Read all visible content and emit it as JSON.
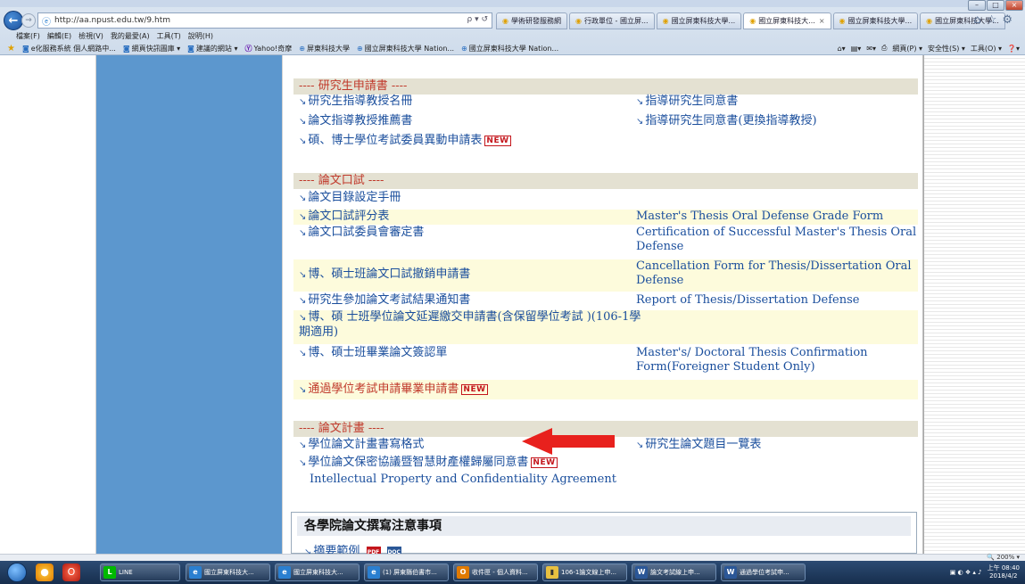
{
  "browser": {
    "url": "http://aa.npust.edu.tw/9.htm",
    "address_controls": "ρ ▾ ↺",
    "tabs": [
      {
        "label": "學術研發服務網",
        "active": false
      },
      {
        "label": "行政單位 - 國立屏...",
        "active": false
      },
      {
        "label": "國立屏東科技大學...",
        "active": false
      },
      {
        "label": "國立屏東科技大...",
        "active": true
      },
      {
        "label": "國立屏東科技大學...",
        "active": false
      },
      {
        "label": "國立屏東科技大學...",
        "active": false
      }
    ],
    "menu": [
      "檔案(F)",
      "編輯(E)",
      "檢視(V)",
      "我的最愛(A)",
      "工具(T)",
      "說明(H)"
    ],
    "favorites": [
      "e化服務系統 個人網路中...",
      "網頁快訊圖庫 ▾",
      "建議的網站 ▾",
      "Yahoo!奇摩",
      "屏東科技大學",
      "國立屏東科技大學 Nation...",
      "國立屏東科技大學 Nation..."
    ],
    "command_bar": [
      "▾",
      "▾",
      "▾",
      "網頁(P) ▾",
      "安全性(S) ▾",
      "工具(O) ▾",
      "▾"
    ],
    "zoom": "200%"
  },
  "sections": {
    "grad_apps": {
      "title": "---- 研究生申請書 ----",
      "rows": [
        {
          "left": "研究生指導教授名冊",
          "right": "指導研究生同意書",
          "new": false
        },
        {
          "left": "論文指導教授推薦書",
          "right": "指導研究生同意書(更換指導教授)",
          "new": false
        },
        {
          "left": "碩、博士學位考試委員異動申請表",
          "right": "",
          "new": true
        }
      ]
    },
    "oral_exam": {
      "title": "---- 論文口試 ----",
      "rows": [
        {
          "left": "論文目錄設定手冊",
          "right": ""
        },
        {
          "left": "論文口試評分表",
          "right": "Master's Thesis Oral Defense Grade Form"
        },
        {
          "left": "論文口試委員會審定書",
          "right": "Certification of Successful Master's Thesis Oral Defense"
        },
        {
          "left": "博、碩士班論文口試撤銷申請書",
          "right": "Cancellation Form for Thesis/Dissertation Oral Defense"
        },
        {
          "left": "研究生參加論文考試結果通知書",
          "right": "Report of Thesis/Dissertation Defense"
        },
        {
          "left": "博、碩 士班學位論文延遲繳交申請書(含保留學位考試 )(106-1學期適用)",
          "right": ""
        },
        {
          "left": "博、碩士班畢業論文簽認單",
          "right": "Master's/ Doctoral Thesis Confirmation Form(Foreigner Student Only)"
        },
        {
          "left": "通過學位考試申請畢業申請書",
          "right": "",
          "new": true
        }
      ]
    },
    "thesis_plan": {
      "title": "---- 論文計畫 ----",
      "rows": [
        {
          "left": "學位論文計畫書寫格式",
          "right": "研究生論文題目一覽表"
        },
        {
          "left": "學位論文保密協議暨智慧財產權歸屬同意書",
          "right": "",
          "new": true,
          "sub": "Intellectual Property and Confidentiality Agreement"
        }
      ]
    },
    "college_notes": {
      "title": "各學院論文撰寫注意事項",
      "abstract": "摘要範例",
      "pdf": "PDF",
      "doc": "DOC"
    }
  },
  "badge_new": "NEW",
  "annotation": {
    "color": "#e8211d"
  },
  "taskbar": {
    "pins": [
      "line-icon"
    ],
    "tasks": [
      "國立屏東科技大...",
      "國立屏東科技大...",
      "(1) 屏東縣伯書市...",
      "收件匣 - 個人資料...",
      "106-1論文線上申...",
      "論文考試線上申...",
      "通過學位考試申..."
    ],
    "line_label": "LINE",
    "clock_time": "上午 08:40",
    "clock_date": "2018/4/2"
  }
}
